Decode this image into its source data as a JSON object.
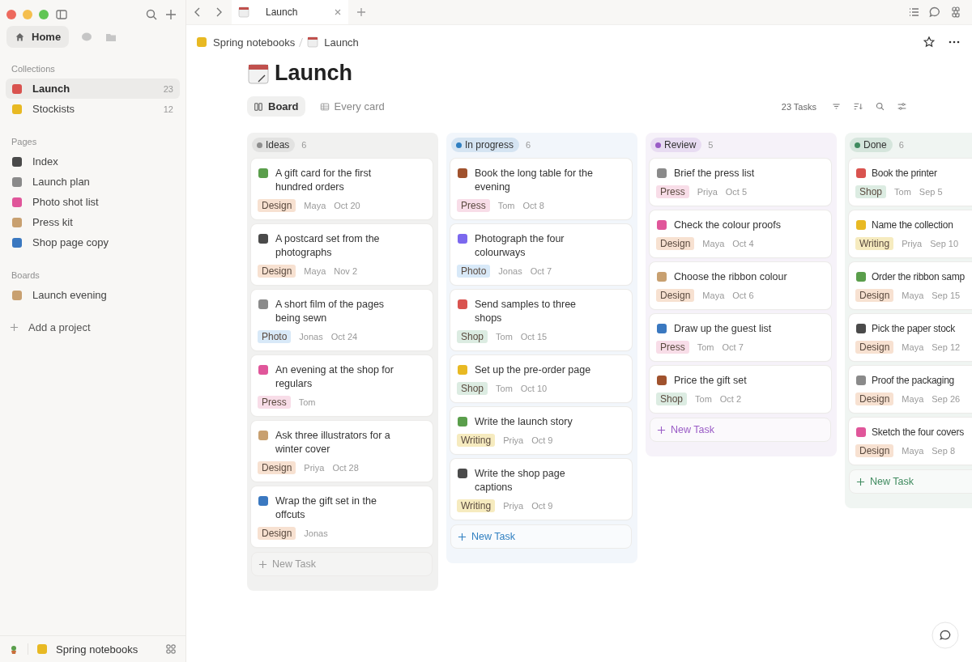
{
  "tab_bar": {
    "tabs": [
      {
        "label": "Launch",
        "selected": true
      }
    ]
  },
  "sidebar": {
    "home": {
      "label": "Home",
      "selected": true
    },
    "sections": [
      {
        "title": "Collections",
        "items": [
          {
            "label": "Launch",
            "count": "23",
            "selected": true
          },
          {
            "label": "Stockists",
            "count": "12",
            "selected": false
          }
        ]
      },
      {
        "title": "Pages",
        "items": [
          {
            "label": "Index",
            "selected": false
          },
          {
            "label": "Launch plan",
            "selected": false
          },
          {
            "label": "Photo shot list",
            "selected": false
          },
          {
            "label": "Press kit",
            "selected": false
          },
          {
            "label": "Shop page copy",
            "selected": false
          }
        ]
      },
      {
        "title": "Boards",
        "items": [
          {
            "label": "Launch evening",
            "selected": false
          }
        ]
      }
    ],
    "add_project": "Add a project",
    "workspace": "Spring notebooks"
  },
  "breadcrumb": [
    "Spring notebooks",
    "Launch"
  ],
  "page_title": "Launch",
  "views": [
    {
      "label": "Board",
      "selected": true
    },
    {
      "label": "Every card",
      "selected": false
    }
  ],
  "task_count": "23 Tasks",
  "columns": [
    {
      "name": "Ideas",
      "count": "6",
      "color": "#8e8e8e",
      "new_task": "New Task",
      "cards": [
        {
          "title": "A gift card for the first hundred orders",
          "tag": {
            "text": "Design",
            "color": "#f7e1d1"
          },
          "owner": "Maya",
          "date": "Oct 20"
        },
        {
          "title": "A postcard set from the photographs",
          "tag": {
            "text": "Design",
            "color": "#f7e1d1"
          },
          "owner": "Maya",
          "date": "Nov 2"
        },
        {
          "title": "A short film of the pages being sewn",
          "tag": {
            "text": "Photo",
            "color": "#d8e9f8"
          },
          "owner": "Jonas",
          "date": "Oct 24"
        },
        {
          "title": "An evening at the shop for regulars",
          "tag": {
            "text": "Press",
            "color": "#f8dde8"
          },
          "owner": "Tom"
        },
        {
          "title": "Ask three illustrators for a winter cover",
          "tag": {
            "text": "Design",
            "color": "#f7e1d1"
          },
          "owner": "Priya",
          "date": "Oct 28"
        },
        {
          "title": "Wrap the gift set in the offcuts",
          "tag": {
            "text": "Design",
            "color": "#f7e1d1"
          },
          "owner": "Jonas"
        }
      ]
    },
    {
      "name": "In progress",
      "count": "6",
      "color": "#2f7fc1",
      "new_task": "New Task",
      "cards": [
        {
          "title": "Book the long table for the evening",
          "tag": {
            "text": "Press",
            "color": "#f8dde8"
          },
          "owner": "Tom",
          "date": "Oct 8"
        },
        {
          "title": "Photograph the four colourways",
          "tag": {
            "text": "Photo",
            "color": "#d8e9f8"
          },
          "owner": "Jonas",
          "date": "Oct 7"
        },
        {
          "title": "Send samples to three shops",
          "tag": {
            "text": "Shop",
            "color": "#dcece2"
          },
          "owner": "Tom",
          "date": "Oct 15"
        },
        {
          "title": "Set up the pre-order page",
          "tag": {
            "text": "Shop",
            "color": "#dcece2"
          },
          "owner": "Tom",
          "date": "Oct 10"
        },
        {
          "title": "Write the launch story",
          "tag": {
            "text": "Writing",
            "color": "#f6ebbf"
          },
          "owner": "Priya",
          "date": "Oct 9"
        },
        {
          "title": "Write the shop page captions",
          "tag": {
            "text": "Writing",
            "color": "#f6ebbf"
          },
          "owner": "Priya",
          "date": "Oct 9"
        }
      ]
    },
    {
      "name": "Review",
      "count": "5",
      "color": "#9a5cc6",
      "new_task": "New Task",
      "cards": [
        {
          "title": "Brief the press list",
          "tag": {
            "text": "Press",
            "color": "#f8dde8"
          },
          "owner": "Priya",
          "date": "Oct 5"
        },
        {
          "title": "Check the colour proofs",
          "tag": {
            "text": "Design",
            "color": "#f7e1d1"
          },
          "owner": "Maya",
          "date": "Oct 4"
        },
        {
          "title": "Choose the ribbon colour",
          "tag": {
            "text": "Design",
            "color": "#f7e1d1"
          },
          "owner": "Maya",
          "date": "Oct 6"
        },
        {
          "title": "Draw up the guest list",
          "tag": {
            "text": "Press",
            "color": "#f8dde8"
          },
          "owner": "Tom",
          "date": "Oct 7"
        },
        {
          "title": "Price the gift set",
          "tag": {
            "text": "Shop",
            "color": "#dcece2"
          },
          "owner": "Tom",
          "date": "Oct 2"
        }
      ]
    },
    {
      "name": "Done",
      "count": "6",
      "color": "#3f8a5f",
      "new_task": "New Task",
      "cards": [
        {
          "title": "Book the printer",
          "tag": {
            "text": "Shop",
            "color": "#dcece2"
          },
          "owner": "Tom",
          "date": "Sep 5"
        },
        {
          "title": "Name the collection",
          "tag": {
            "text": "Writing",
            "color": "#f6ebbf"
          },
          "owner": "Priya",
          "date": "Sep 10"
        },
        {
          "title": "Order the ribbon samp",
          "tag": {
            "text": "Design",
            "color": "#f7e1d1"
          },
          "owner": "Maya",
          "date": "Sep 15"
        },
        {
          "title": "Pick the paper stock",
          "tag": {
            "text": "Design",
            "color": "#f7e1d1"
          },
          "owner": "Maya",
          "date": "Sep 12"
        },
        {
          "title": "Proof the packaging",
          "tag": {
            "text": "Design",
            "color": "#f7e1d1"
          },
          "owner": "Maya",
          "date": "Sep 26"
        },
        {
          "title": "Sketch the four covers",
          "tag": {
            "text": "Design",
            "color": "#f7e1d1"
          },
          "owner": "Maya",
          "date": "Sep 8"
        }
      ]
    }
  ]
}
